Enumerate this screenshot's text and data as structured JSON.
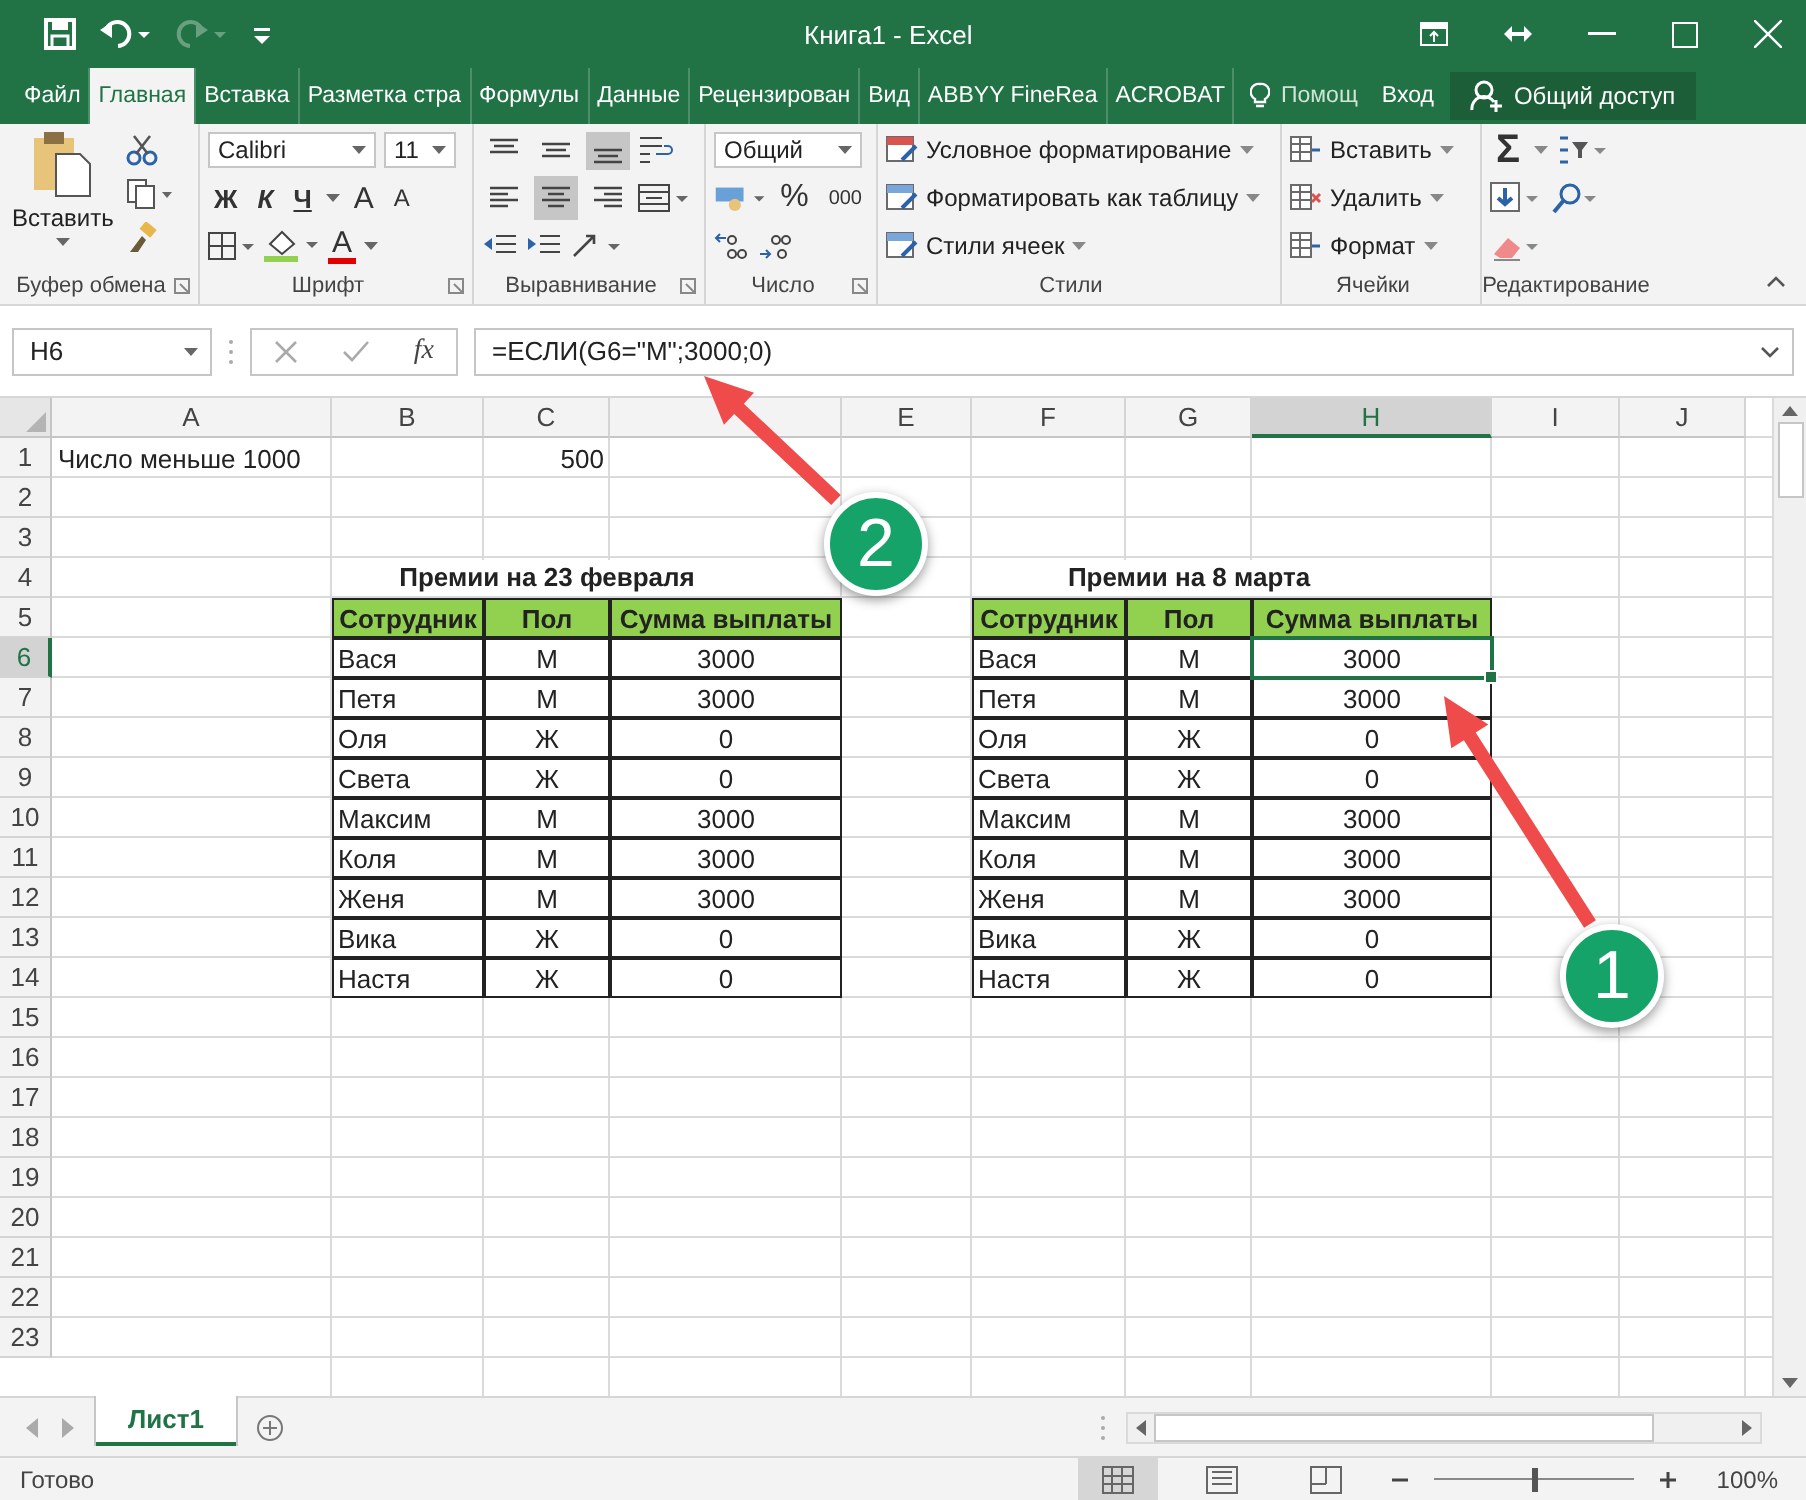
{
  "window": {
    "title": "Книга1 - Excel"
  },
  "menu_tabs": [
    {
      "label": "Файл",
      "kind": "tab",
      "selected": false
    },
    {
      "label": "Главная",
      "kind": "tab",
      "selected": true
    },
    {
      "label": "Вставка",
      "kind": "tab",
      "selected": false
    },
    {
      "label": "Разметка стра",
      "kind": "tab",
      "selected": false
    },
    {
      "label": "Формулы",
      "kind": "tab",
      "selected": false
    },
    {
      "label": "Данные",
      "kind": "tab",
      "selected": false
    },
    {
      "label": "Рецензирован",
      "kind": "tab",
      "selected": false
    },
    {
      "label": "Вид",
      "kind": "tab",
      "selected": false
    },
    {
      "label": "ABBYY FineRea",
      "kind": "tab",
      "selected": false
    },
    {
      "label": "ACROBAT",
      "kind": "tab",
      "selected": false
    },
    {
      "label": "Помощ",
      "kind": "tell",
      "selected": false
    },
    {
      "label": "Вход",
      "kind": "link",
      "selected": false
    },
    {
      "label": "Общий доступ",
      "kind": "share"
    }
  ],
  "ribbon": {
    "groups": [
      {
        "kind": "clipboard",
        "label": "Буфер обмена",
        "paste": "Вставить"
      },
      {
        "kind": "font",
        "label": "Шрифт",
        "font": "Calibri",
        "size": "11",
        "bold": "Ж",
        "italic": "К",
        "underline": "Ч",
        "grow": "A",
        "shrink": "A",
        "color_letter": "A"
      },
      {
        "kind": "alignment",
        "label": "Выравнивание",
        "vertical": [
          {
            "selected": false
          },
          {
            "selected": false
          },
          {
            "selected": true
          }
        ],
        "horizontal": [
          {
            "selected": false
          },
          {
            "selected": true
          },
          {
            "selected": false
          }
        ]
      },
      {
        "kind": "number",
        "label": "Число",
        "format": "Общий",
        "percent": "%",
        "thousands": "000"
      },
      {
        "kind": "styles",
        "label": "Стили",
        "items": [
          "Условное форматирование",
          "Форматировать как таблицу",
          "Стили ячеек"
        ]
      },
      {
        "kind": "cells",
        "label": "Ячейки",
        "items": [
          "Вставить",
          "Удалить",
          "Формат"
        ]
      },
      {
        "kind": "editing",
        "label": "Редактирование",
        "sum": "Σ"
      }
    ]
  },
  "formula_bar": {
    "name_box": "H6",
    "function_label": "fx",
    "formula": "=ЕСЛИ(G6=\"М\";3000;0)"
  },
  "grid": {
    "columns": [
      {
        "label": "A"
      },
      {
        "label": "B"
      },
      {
        "label": "C"
      },
      {},
      {
        "label": "E"
      },
      {
        "label": "F"
      },
      {
        "label": "G"
      },
      {
        "label": "H"
      },
      {
        "label": "I"
      },
      {
        "label": "J"
      }
    ],
    "rows": [
      {
        "number": "1",
        "cells": [
          {
            "text": "Число меньше 1000",
            "kind": "plain",
            "selected": false
          },
          {
            "text": ""
          },
          {
            "text": "500",
            "kind": "number",
            "selected": false
          }
        ]
      },
      {
        "number": "2",
        "cells": []
      },
      {
        "number": "3",
        "cells": []
      },
      {
        "number": "4",
        "cells": [
          {
            "text": ""
          },
          {
            "text": ""
          },
          {
            "text": "Премии на 23 февраля",
            "kind": "title",
            "selected": false
          },
          {
            "text": ""
          },
          {
            "text": ""
          },
          {
            "text": ""
          },
          {
            "text": "Премии на 8 марта",
            "kind": "title",
            "selected": false
          }
        ]
      },
      {
        "number": "5",
        "cells": [
          {
            "text": ""
          },
          {
            "text": "Сотрудник",
            "kind": "header",
            "selected": false
          },
          {
            "text": "Пол",
            "kind": "header",
            "selected": false
          },
          {
            "text": "Сумма выплаты",
            "kind": "header",
            "selected": false
          },
          {
            "text": ""
          },
          {
            "text": "Сотрудник",
            "kind": "header",
            "selected": false
          },
          {
            "text": "Пол",
            "kind": "header",
            "selected": false
          },
          {
            "text": "Сумма выплаты",
            "kind": "header",
            "selected": false
          }
        ]
      },
      {
        "number": "6",
        "cells": [
          {
            "text": ""
          },
          {
            "text": "Вася",
            "kind": "name",
            "selected": false
          },
          {
            "text": "М",
            "kind": "center",
            "selected": false
          },
          {
            "text": "3000",
            "kind": "center",
            "selected": false
          },
          {
            "text": ""
          },
          {
            "text": "Вася",
            "kind": "name",
            "selected": false
          },
          {
            "text": "М",
            "kind": "center",
            "selected": false
          },
          {
            "text": "3000",
            "kind": "center",
            "selected": true
          }
        ]
      },
      {
        "number": "7",
        "cells": [
          {
            "text": ""
          },
          {
            "text": "Петя",
            "kind": "name",
            "selected": false
          },
          {
            "text": "М",
            "kind": "center",
            "selected": false
          },
          {
            "text": "3000",
            "kind": "center",
            "selected": false
          },
          {
            "text": ""
          },
          {
            "text": "Петя",
            "kind": "name",
            "selected": false
          },
          {
            "text": "М",
            "kind": "center",
            "selected": false
          },
          {
            "text": "3000",
            "kind": "center",
            "selected": false
          }
        ]
      },
      {
        "number": "8",
        "cells": [
          {
            "text": ""
          },
          {
            "text": "Оля",
            "kind": "name",
            "selected": false
          },
          {
            "text": "Ж",
            "kind": "center",
            "selected": false
          },
          {
            "text": "0",
            "kind": "center",
            "selected": false
          },
          {
            "text": ""
          },
          {
            "text": "Оля",
            "kind": "name",
            "selected": false
          },
          {
            "text": "Ж",
            "kind": "center",
            "selected": false
          },
          {
            "text": "0",
            "kind": "center",
            "selected": false
          }
        ]
      },
      {
        "number": "9",
        "cells": [
          {
            "text": ""
          },
          {
            "text": "Света",
            "kind": "name",
            "selected": false
          },
          {
            "text": "Ж",
            "kind": "center",
            "selected": false
          },
          {
            "text": "0",
            "kind": "center",
            "selected": false
          },
          {
            "text": ""
          },
          {
            "text": "Света",
            "kind": "name",
            "selected": false
          },
          {
            "text": "Ж",
            "kind": "center",
            "selected": false
          },
          {
            "text": "0",
            "kind": "center",
            "selected": false
          }
        ]
      },
      {
        "number": "10",
        "cells": [
          {
            "text": ""
          },
          {
            "text": "Максим",
            "kind": "name",
            "selected": false
          },
          {
            "text": "М",
            "kind": "center",
            "selected": false
          },
          {
            "text": "3000",
            "kind": "center",
            "selected": false
          },
          {
            "text": ""
          },
          {
            "text": "Максим",
            "kind": "name",
            "selected": false
          },
          {
            "text": "М",
            "kind": "center",
            "selected": false
          },
          {
            "text": "3000",
            "kind": "center",
            "selected": false
          }
        ]
      },
      {
        "number": "11",
        "cells": [
          {
            "text": ""
          },
          {
            "text": "Коля",
            "kind": "name",
            "selected": false
          },
          {
            "text": "М",
            "kind": "center",
            "selected": false
          },
          {
            "text": "3000",
            "kind": "center",
            "selected": false
          },
          {
            "text": ""
          },
          {
            "text": "Коля",
            "kind": "name",
            "selected": false
          },
          {
            "text": "М",
            "kind": "center",
            "selected": false
          },
          {
            "text": "3000",
            "kind": "center",
            "selected": false
          }
        ]
      },
      {
        "number": "12",
        "cells": [
          {
            "text": ""
          },
          {
            "text": "Женя",
            "kind": "name",
            "selected": false
          },
          {
            "text": "М",
            "kind": "center",
            "selected": false
          },
          {
            "text": "3000",
            "kind": "center",
            "selected": false
          },
          {
            "text": ""
          },
          {
            "text": "Женя",
            "kind": "name",
            "selected": false
          },
          {
            "text": "М",
            "kind": "center",
            "selected": false
          },
          {
            "text": "3000",
            "kind": "center",
            "selected": false
          }
        ]
      },
      {
        "number": "13",
        "cells": [
          {
            "text": ""
          },
          {
            "text": "Вика",
            "kind": "name",
            "selected": false
          },
          {
            "text": "Ж",
            "kind": "center",
            "selected": false
          },
          {
            "text": "0",
            "kind": "center",
            "selected": false
          },
          {
            "text": ""
          },
          {
            "text": "Вика",
            "kind": "name",
            "selected": false
          },
          {
            "text": "Ж",
            "kind": "center",
            "selected": false
          },
          {
            "text": "0",
            "kind": "center",
            "selected": false
          }
        ]
      },
      {
        "number": "14",
        "cells": [
          {
            "text": ""
          },
          {
            "text": "Настя",
            "kind": "name",
            "selected": false
          },
          {
            "text": "Ж",
            "kind": "center",
            "selected": false
          },
          {
            "text": "0",
            "kind": "center",
            "selected": false
          },
          {
            "text": ""
          },
          {
            "text": "Настя",
            "kind": "name",
            "selected": false
          },
          {
            "text": "Ж",
            "kind": "center",
            "selected": false
          },
          {
            "text": "0",
            "kind": "center",
            "selected": false
          }
        ]
      },
      {
        "number": "15",
        "cells": []
      },
      {
        "number": "16",
        "cells": []
      },
      {
        "number": "17",
        "cells": []
      },
      {
        "number": "18",
        "cells": []
      },
      {
        "number": "19",
        "cells": []
      },
      {
        "number": "20",
        "cells": []
      },
      {
        "number": "21",
        "cells": []
      },
      {
        "number": "22",
        "cells": []
      },
      {
        "number": "23",
        "cells": []
      }
    ]
  },
  "sheet_tabs": [
    {
      "label": "Лист1",
      "selected": true
    }
  ],
  "status_bar": {
    "text": "Готово",
    "views": [
      {
        "selected": true
      },
      {
        "selected": false
      },
      {
        "selected": false
      }
    ],
    "zoom_slider": {
      "level": 0.5
    },
    "zoom": "100%"
  },
  "annotations": [
    {
      "label": "1"
    },
    {
      "label": "2"
    }
  ]
}
